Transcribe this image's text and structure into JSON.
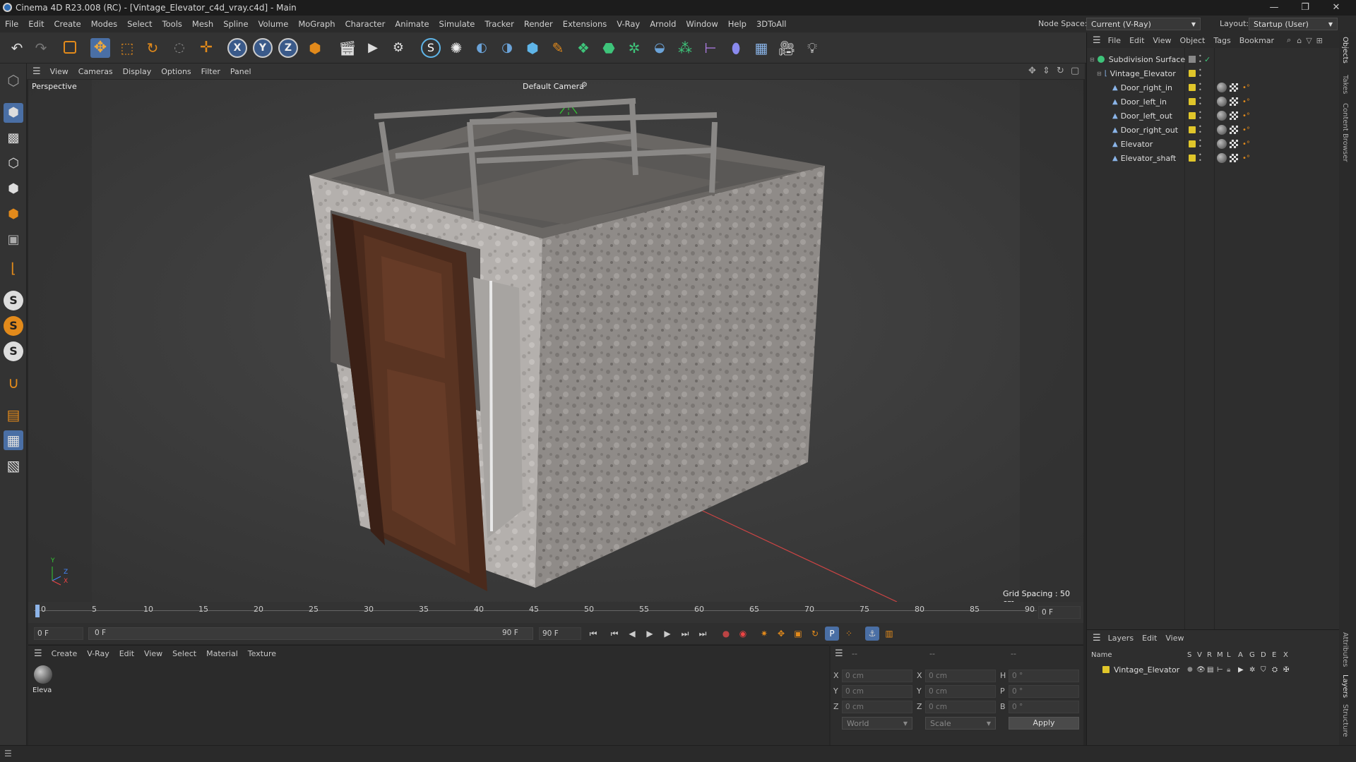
{
  "title": "Cinema 4D R23.008 (RC) - [Vintage_Elevator_c4d_vray.c4d] - Main",
  "window_controls": {
    "minimize": "—",
    "restore": "❐",
    "close": "✕"
  },
  "menu": [
    "File",
    "Edit",
    "Create",
    "Modes",
    "Select",
    "Tools",
    "Mesh",
    "Spline",
    "Volume",
    "MoGraph",
    "Character",
    "Animate",
    "Simulate",
    "Tracker",
    "Render",
    "Extensions",
    "V-Ray",
    "Arnold",
    "Window",
    "Help",
    "3DToAll"
  ],
  "node_space": {
    "label": "Node Space:",
    "value": "Current (V-Ray)"
  },
  "layout": {
    "label": "Layout:",
    "value": "Startup (User)"
  },
  "viewport": {
    "menu": [
      "View",
      "Cameras",
      "Display",
      "Options",
      "Filter",
      "Panel"
    ],
    "name": "Perspective",
    "camera": "Default Camera",
    "grid_spacing": "Grid Spacing : 50 cm",
    "axis": {
      "y": "Y",
      "z": "Z",
      "x": "X"
    }
  },
  "timeline": {
    "ticks": [
      "0",
      "5",
      "10",
      "15",
      "20",
      "25",
      "30",
      "35",
      "40",
      "45",
      "50",
      "55",
      "60",
      "65",
      "70",
      "75",
      "80",
      "85",
      "90"
    ],
    "end_field": "0 F"
  },
  "transport": {
    "current": "0 F",
    "range_start": "0 F",
    "range_end": "90 F",
    "end": "90 F"
  },
  "material_manager": {
    "menu": [
      "Create",
      "V-Ray",
      "Edit",
      "View",
      "Select",
      "Material",
      "Texture"
    ],
    "materials": [
      {
        "name": "Eleva"
      }
    ]
  },
  "coordinates": {
    "header_left": "--",
    "header_mid": "--",
    "header_right": "--",
    "rows": [
      {
        "l1": "X",
        "v1": "0 cm",
        "l2": "X",
        "v2": "0 cm",
        "l3": "H",
        "v3": "0 °"
      },
      {
        "l1": "Y",
        "v1": "0 cm",
        "l2": "Y",
        "v2": "0 cm",
        "l3": "P",
        "v3": "0 °"
      },
      {
        "l1": "Z",
        "v1": "0 cm",
        "l2": "Z",
        "v2": "0 cm",
        "l3": "B",
        "v3": "0 °"
      }
    ],
    "world": "World",
    "scale": "Scale",
    "apply": "Apply"
  },
  "object_manager": {
    "menu": [
      "File",
      "Edit",
      "View",
      "Object",
      "Tags",
      "Bookmar"
    ],
    "objects": [
      {
        "name": "Subdivision Surface",
        "level": 0
      },
      {
        "name": "Vintage_Elevator",
        "level": 1
      },
      {
        "name": "Door_right_in",
        "level": 2
      },
      {
        "name": "Door_left_in",
        "level": 2
      },
      {
        "name": "Door_left_out",
        "level": 2
      },
      {
        "name": "Door_right_out",
        "level": 2
      },
      {
        "name": "Elevator",
        "level": 2
      },
      {
        "name": "Elevator_shaft",
        "level": 2
      }
    ]
  },
  "layer_manager": {
    "menu": [
      "Layers",
      "Edit",
      "View"
    ],
    "columns": [
      "Name",
      "S",
      "V",
      "R",
      "M",
      "L",
      "A",
      "G",
      "D",
      "E",
      "X"
    ],
    "layers": [
      {
        "name": "Vintage_Elevator",
        "color": "#e0c62a"
      }
    ]
  },
  "side_tabs": [
    "Objects",
    "Takes",
    "Content Browser",
    "Attributes",
    "Layers",
    "Structure"
  ],
  "colors": {
    "accent": "#e0c62a",
    "active_blue": "#4a82c4"
  }
}
